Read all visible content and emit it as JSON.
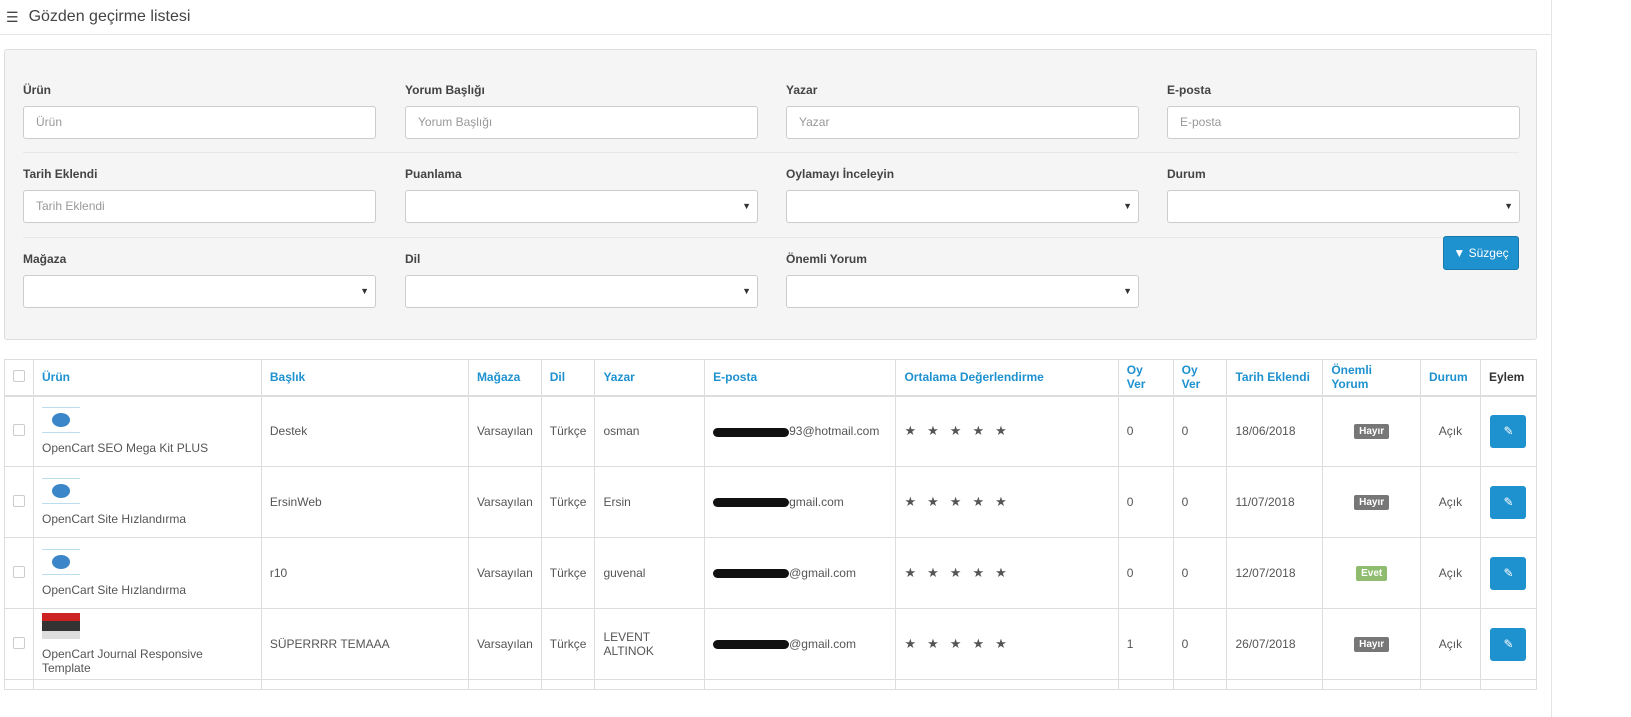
{
  "header": {
    "title": "Gözden geçirme listesi",
    "icon": "list-icon"
  },
  "filter": {
    "fields": [
      {
        "label": "Ürün",
        "placeholder": "Ürün"
      },
      {
        "label": "Yorum Başlığı",
        "placeholder": "Yorum Başlığı"
      },
      {
        "label": "Yazar",
        "placeholder": "Yazar"
      },
      {
        "label": "E-posta",
        "placeholder": "E-posta"
      },
      {
        "label": "Tarih Eklendi",
        "placeholder": "Tarih Eklendi"
      },
      {
        "label": "Puanlama",
        "value": ""
      },
      {
        "label": "Oylamayı İnceleyin",
        "value": ""
      },
      {
        "label": "Durum",
        "value": ""
      },
      {
        "label": "Mağaza",
        "value": ""
      },
      {
        "label": "Dil",
        "value": ""
      },
      {
        "label": "Önemli Yorum",
        "value": ""
      }
    ],
    "button": "Süzgeç"
  },
  "table": {
    "columns": [
      "Ürün",
      "Başlık",
      "Mağaza",
      "Dil",
      "Yazar",
      "E-posta",
      "Ortalama Değerlendirme",
      "Oy Ver",
      "Oy Ver",
      "Tarih Eklendi",
      "Önemli Yorum",
      "Durum",
      "Eylem"
    ],
    "rows": [
      {
        "product": "OpenCart SEO Mega Kit PLUS",
        "title": "Destek",
        "store": "Varsayılan",
        "lang": "Türkçe",
        "author": "osman",
        "email": "93@hotmail.com",
        "rating": 5,
        "vote1": "0",
        "vote2": "0",
        "date": "18/06/2018",
        "important": "Hayır",
        "status": "Açık"
      },
      {
        "product": "OpenCart Site Hızlandırma",
        "title": "ErsinWeb",
        "store": "Varsayılan",
        "lang": "Türkçe",
        "author": "Ersin",
        "email": "gmail.com",
        "rating": 5,
        "vote1": "0",
        "vote2": "0",
        "date": "11/07/2018",
        "important": "Hayır",
        "status": "Açık"
      },
      {
        "product": "OpenCart Site Hızlandırma",
        "title": "r10",
        "store": "Varsayılan",
        "lang": "Türkçe",
        "author": "guvenal",
        "email": "@gmail.com",
        "rating": 5,
        "vote1": "0",
        "vote2": "0",
        "date": "12/07/2018",
        "important": "Evet",
        "status": "Açık"
      },
      {
        "product": "OpenCart Journal Responsive Template",
        "title": "SÜPERRRR TEMAAA",
        "store": "Varsayılan",
        "lang": "Türkçe",
        "author": "LEVENT ALTINOK",
        "email": "@gmail.com",
        "rating": 5,
        "vote1": "1",
        "vote2": "0",
        "date": "26/07/2018",
        "important": "Hayır",
        "status": "Açık"
      }
    ]
  },
  "colors": {
    "accent": "#1e91cf",
    "badge_no": "#777777",
    "badge_yes": "#8fbc6f"
  }
}
